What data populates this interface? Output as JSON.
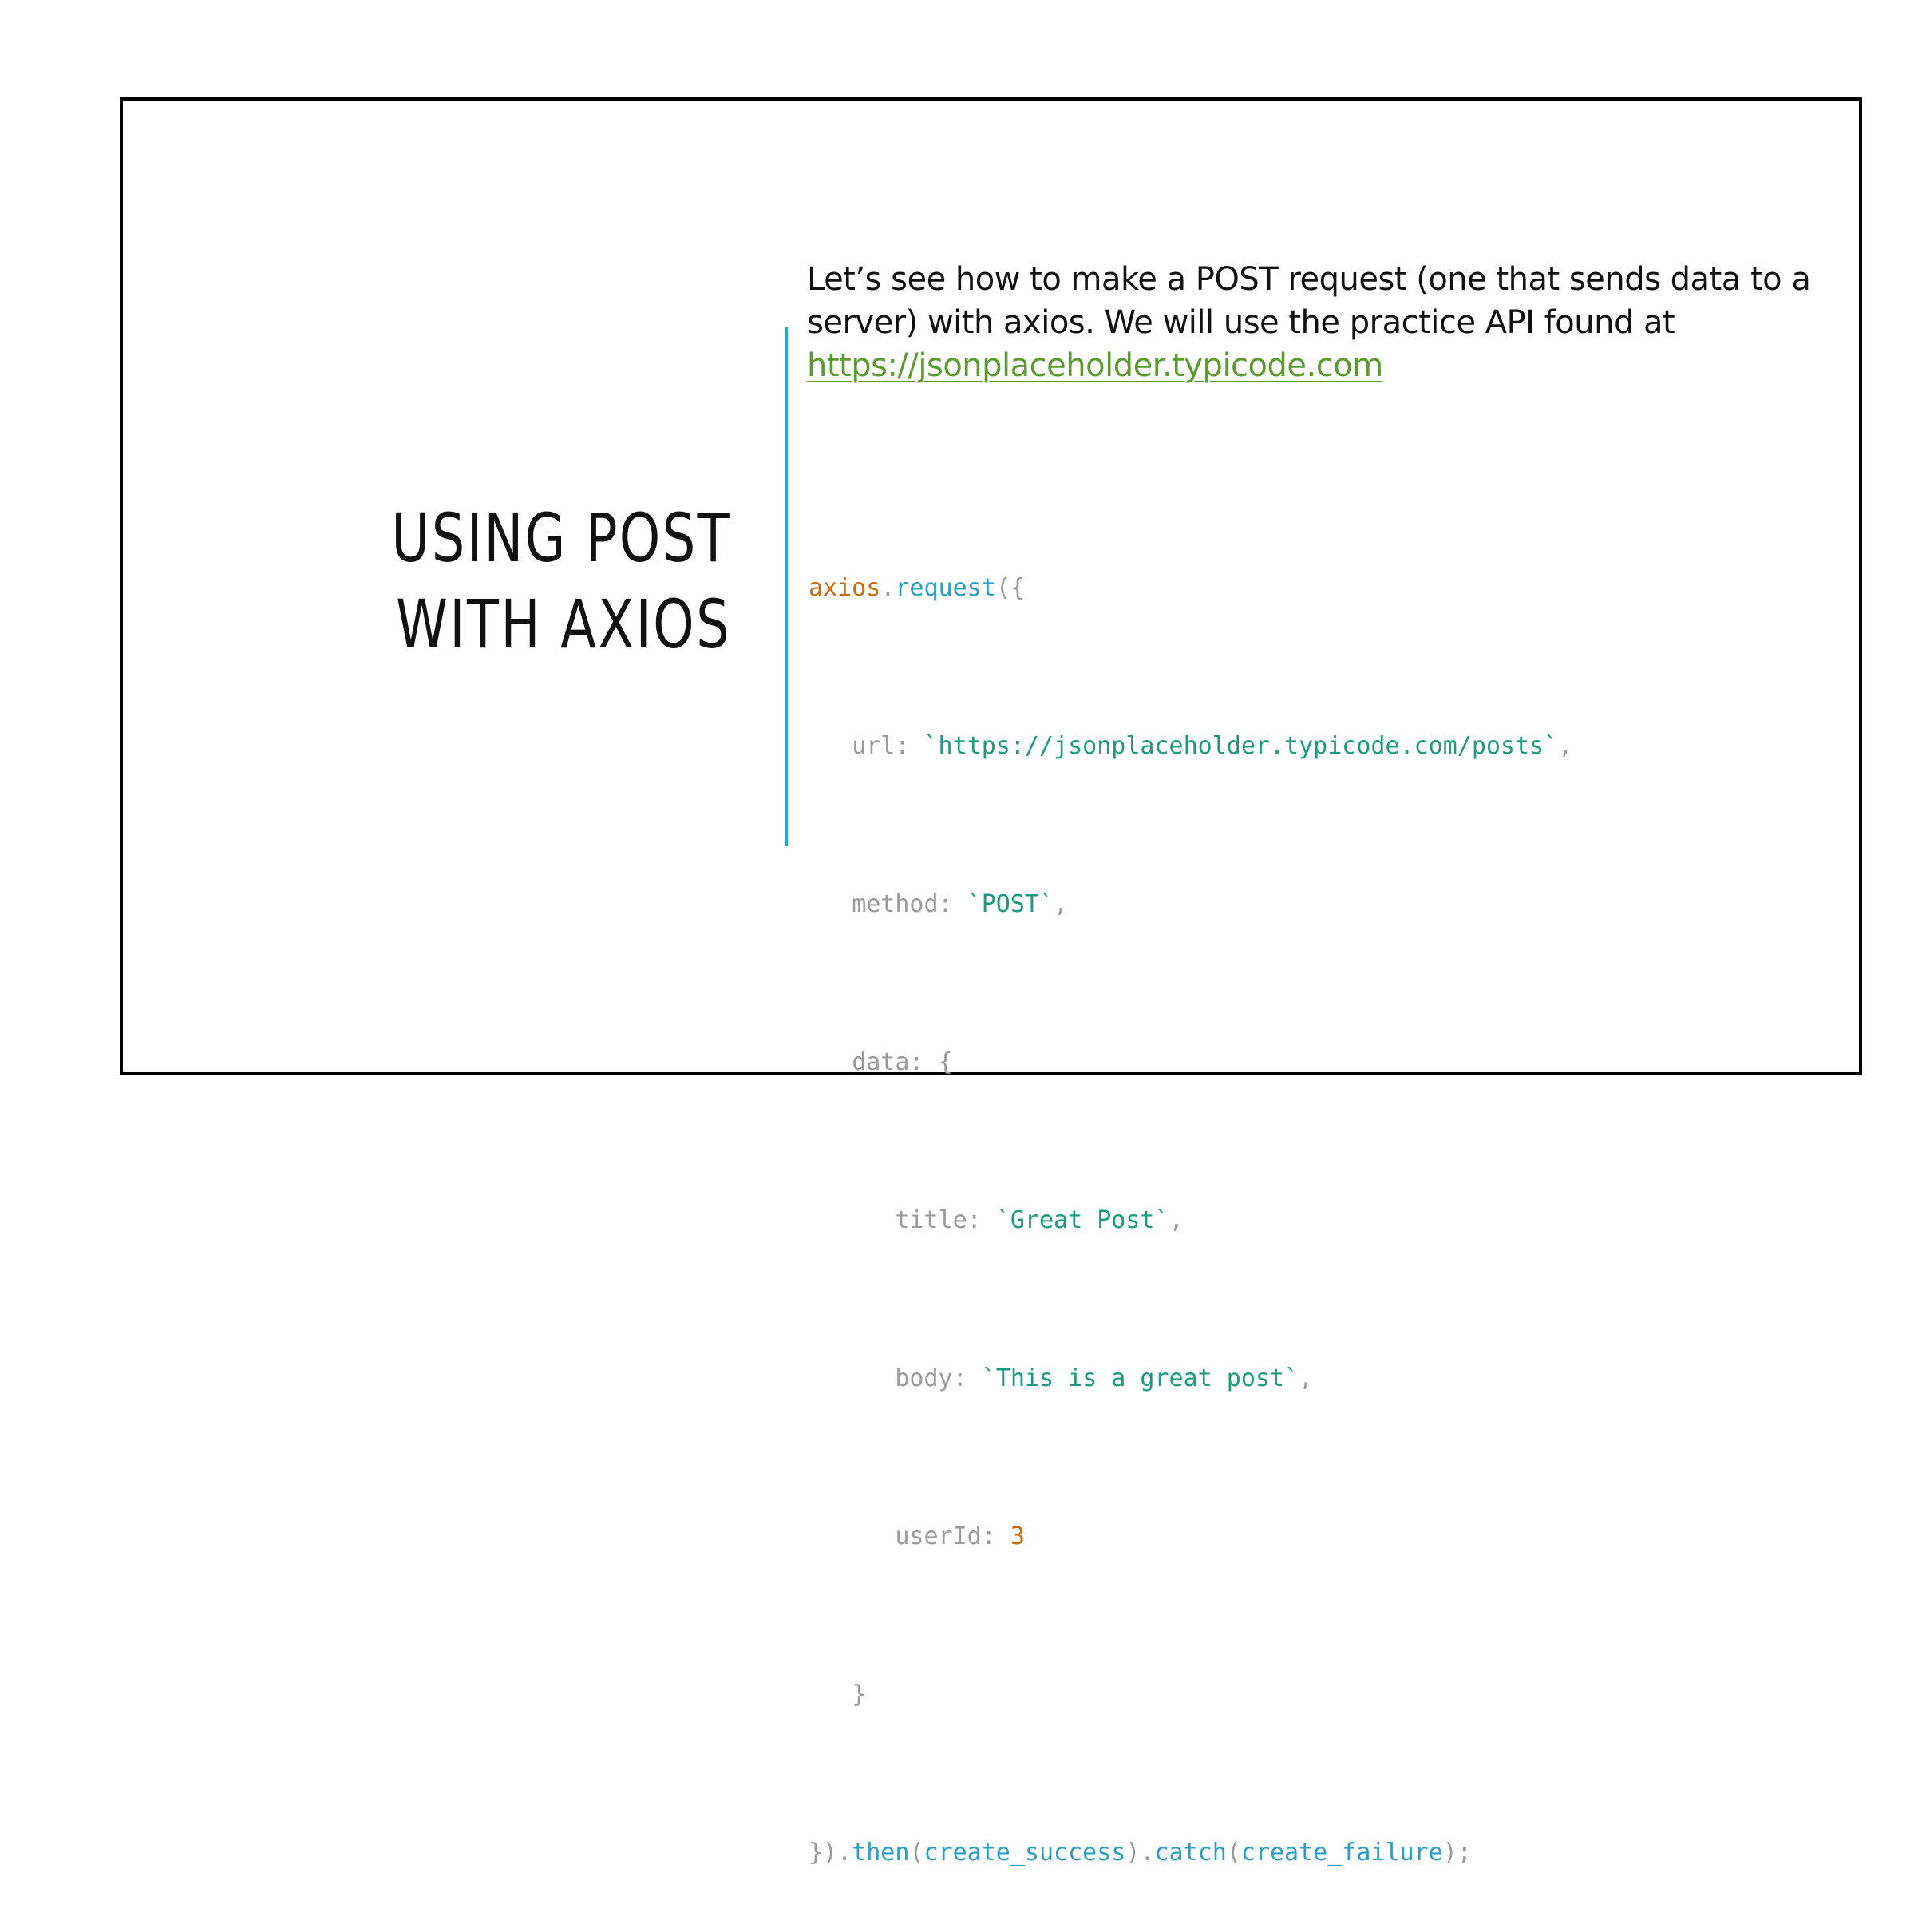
{
  "slide": {
    "title_lines": [
      "USING POST",
      "WITH AXIOS"
    ],
    "intro": {
      "line1": "Let’s see how to make a POST request (one that sends data to a",
      "line2": "server) with axios. We will use the practice API  found at",
      "link": "https://jsonplaceholder.typicode.com"
    },
    "code": {
      "l1": {
        "obj": "axios",
        "dot": ".",
        "fn": "request",
        "punc": "({"
      },
      "l2": {
        "key": "url: ",
        "str": "`https://jsonplaceholder.typicode.com/posts`",
        "punc": ","
      },
      "l3": {
        "key": "method: ",
        "str": "`POST`",
        "punc": ","
      },
      "l4": {
        "key": "data: {"
      },
      "l5": {
        "key": "title: ",
        "str": "`Great Post`",
        "punc": ","
      },
      "l6": {
        "key": "body: ",
        "str": "`This is a great post`",
        "punc": ","
      },
      "l7": {
        "key": "userId: ",
        "num": "3"
      },
      "l8": {
        "punc": "}"
      },
      "l9": {
        "punc1": "}).",
        "fn1": "then",
        "punc2": "(",
        "arg1": "create_success",
        "punc3": ").",
        "fn2": "catch",
        "punc4": "(",
        "arg2": "create_failure",
        "punc5": ");"
      }
    },
    "colors": {
      "accent_rule": "#2ca4d2",
      "link": "#5a9a2f",
      "code_object": "#c56c13",
      "code_function": "#2a9ec4",
      "code_string": "#1d9a7f",
      "code_number": "#c56c13",
      "code_plain": "#9b9b9b"
    }
  }
}
